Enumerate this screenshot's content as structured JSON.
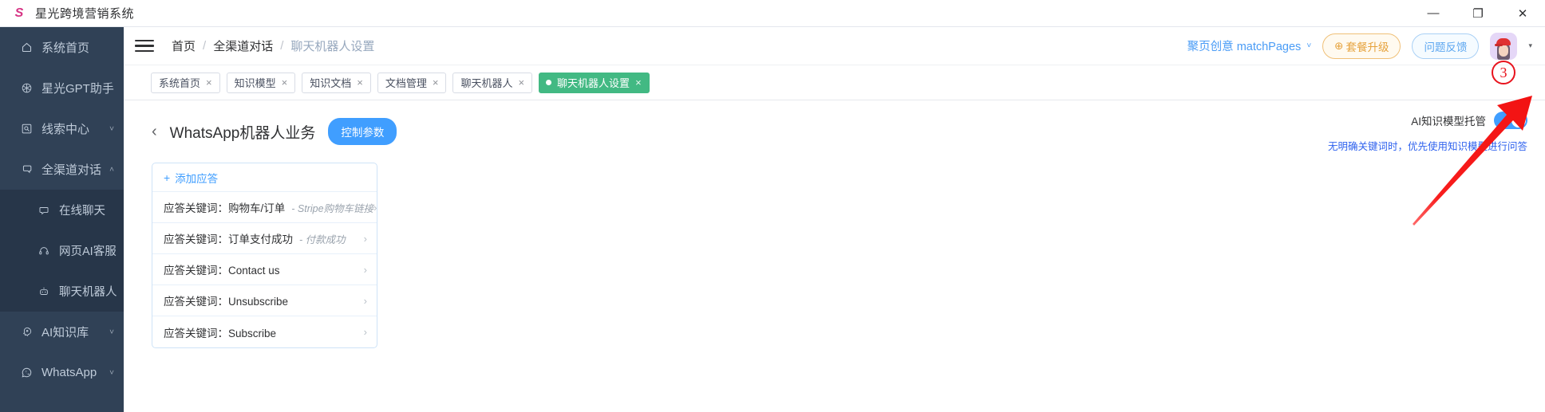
{
  "window": {
    "app_logo": "s-logo-icon",
    "title": "星光跨境营销系统",
    "minimize": "—",
    "maximize": "❐",
    "close": "✕"
  },
  "sidebar": {
    "items": [
      {
        "label": "系统首页",
        "icon": "home-icon",
        "level": "top",
        "chevron": ""
      },
      {
        "label": "星光GPT助手",
        "icon": "gpt-icon",
        "level": "top",
        "chevron": ""
      },
      {
        "label": "线索中心",
        "icon": "lead-icon",
        "level": "top",
        "chevron": "˅"
      },
      {
        "label": "全渠道对话",
        "icon": "chat-icon",
        "level": "top",
        "chevron": "˄"
      },
      {
        "label": "在线聊天",
        "icon": "message-icon",
        "level": "sub",
        "chevron": ""
      },
      {
        "label": "网页AI客服",
        "icon": "headset-icon",
        "level": "sub",
        "chevron": ""
      },
      {
        "label": "聊天机器人",
        "icon": "robot-icon",
        "level": "sub",
        "chevron": ""
      },
      {
        "label": "AI知识库",
        "icon": "brain-icon",
        "level": "top",
        "chevron": "˅"
      },
      {
        "label": "WhatsApp",
        "icon": "whatsapp-icon",
        "level": "top",
        "chevron": "˅"
      }
    ]
  },
  "header": {
    "menu_toggle": "hamburger-icon",
    "breadcrumb": [
      {
        "label": "首页",
        "current": false
      },
      {
        "label": "全渠道对话",
        "current": false
      },
      {
        "label": "聊天机器人设置",
        "current": true
      }
    ],
    "separator": "/",
    "account": "聚页创意 matchPages",
    "account_caret": "˅",
    "upgrade_button": "套餐升级",
    "upgrade_icon": "⊕",
    "feedback_button": "问题反馈",
    "avatar": "user-avatar",
    "avatar_caret": "▾"
  },
  "tabs": {
    "close_glyph": "×",
    "items": [
      {
        "label": "系统首页",
        "active": false
      },
      {
        "label": "知识模型",
        "active": false
      },
      {
        "label": "知识文档",
        "active": false
      },
      {
        "label": "文档管理",
        "active": false
      },
      {
        "label": "聊天机器人",
        "active": false
      },
      {
        "label": "聊天机器人设置",
        "active": true
      }
    ]
  },
  "page": {
    "back_icon": "‹",
    "title": "WhatsApp机器人业务",
    "control_params_button": "控制参数"
  },
  "responses_card": {
    "add_label": "添加应答",
    "add_icon": "+",
    "chevron": "›",
    "rows": [
      {
        "keyword": "应答关键词：购物车/订单",
        "note": "- Stripe购物车链接"
      },
      {
        "keyword": "应答关键词：订单支付成功",
        "note": "- 付款成功"
      },
      {
        "keyword": "应答关键词：Contact us",
        "note": ""
      },
      {
        "keyword": "应答关键词：Unsubscribe",
        "note": ""
      },
      {
        "keyword": "应答关键词：Subscribe",
        "note": ""
      }
    ]
  },
  "ai_panel": {
    "label": "AI知识模型托管",
    "toggle_state": "on",
    "hint": "无明确关键词时，优先使用知识模型进行问答"
  },
  "annotations": {
    "step_badge": "3",
    "arrow": "red-arrow"
  },
  "colors": {
    "sidebar_bg": "#304156",
    "sidebar_sub_bg": "#273649",
    "accent_blue": "#409eff",
    "tab_active_green": "#42b983",
    "annotation_red": "#e8131d",
    "hint_blue": "#2f62ee",
    "upgrade_orange": "#e6a23c"
  }
}
